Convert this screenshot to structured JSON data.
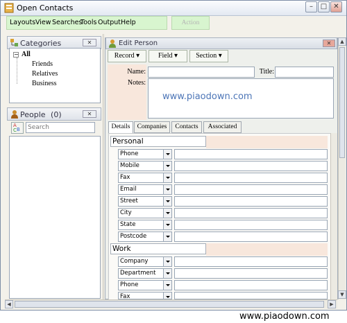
{
  "window": {
    "title": "Open Contacts",
    "controls": [
      "–",
      "□",
      "✕"
    ]
  },
  "menubar": {
    "items": [
      "Layouts",
      "View",
      "Searches",
      "Tools",
      "Output",
      "Help"
    ]
  },
  "toolbar": {
    "action_label": "Action"
  },
  "categories": {
    "title": "Categories",
    "close_label": "✕",
    "root": "All",
    "items": [
      "Friends",
      "Relatives",
      "Business"
    ]
  },
  "people": {
    "title": "People",
    "count": "(0)",
    "close_label": "✕",
    "search_placeholder": "Search"
  },
  "edit_person": {
    "title": "Edit Person",
    "buttons": {
      "record": "Record ▾",
      "field": "Field ▾",
      "section": "Section ▾"
    },
    "name_label": "Name:",
    "title_label": "Title:",
    "notes_label": "Notes:",
    "notes_value": "www.piaodown.com",
    "tabs": [
      "Details",
      "Companies",
      "Contacts",
      "Associated"
    ],
    "sections": {
      "personal": {
        "label": "Personal",
        "fields": [
          "Phone",
          "Mobile",
          "Fax",
          "Email",
          "Street",
          "City",
          "State",
          "Postcode"
        ]
      },
      "work": {
        "label": "Work",
        "fields": [
          "Company",
          "Department",
          "Phone",
          "Fax"
        ]
      }
    }
  },
  "watermark": "www.piaodown.com",
  "colors": {
    "menubar_bg": "#d8f5cf",
    "notes_text": "#4c75b7",
    "section_bg": "#f8e7dc"
  }
}
